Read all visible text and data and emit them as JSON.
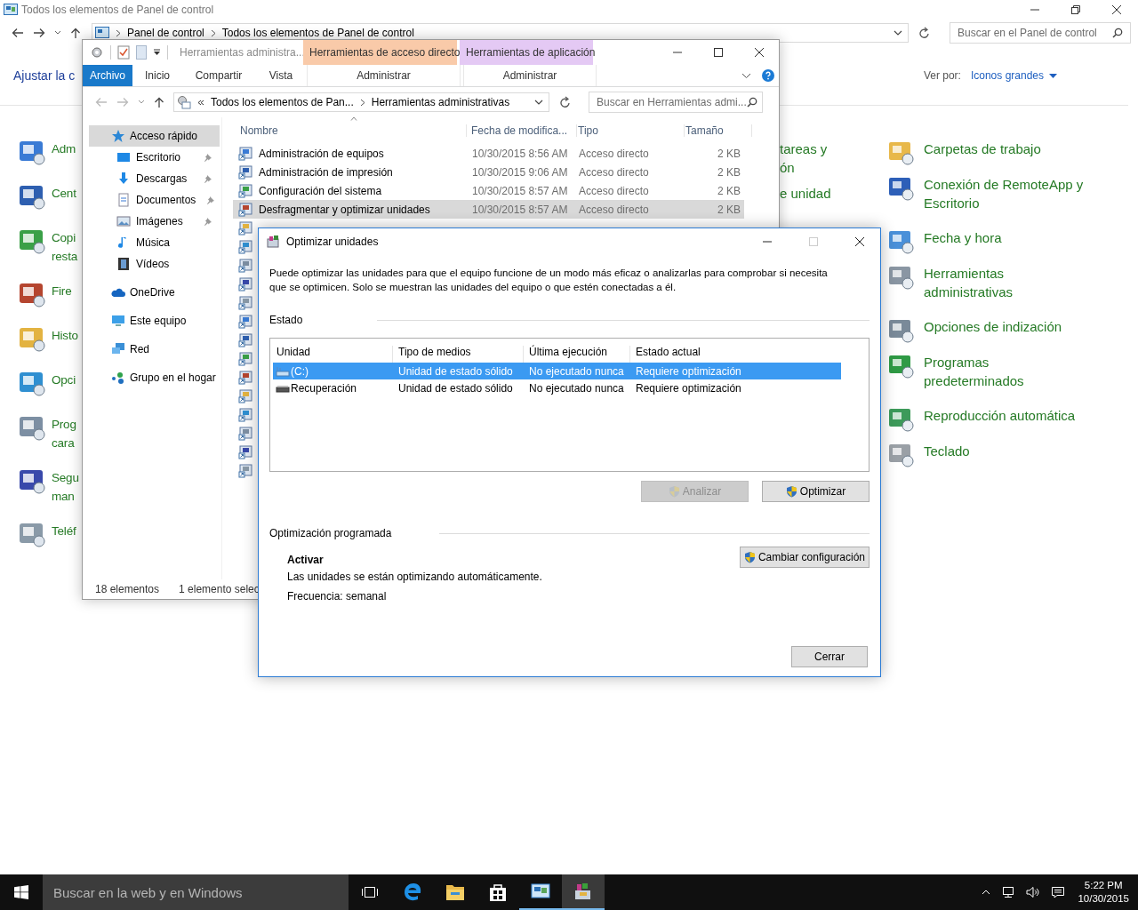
{
  "control_panel": {
    "title": "Todos los elementos de Panel de control",
    "address": [
      "Panel de control",
      "Todos los elementos de Panel de control"
    ],
    "search": {
      "placeholder": "Buscar en el Panel de control"
    },
    "heading": "Ajustar la c",
    "view_by": {
      "label": "Ver por:",
      "value": "Iconos grandes"
    },
    "left_items": [
      {
        "lines": [
          "Adm"
        ]
      },
      {
        "lines": [
          "Cent"
        ]
      },
      {
        "lines": [
          "Copi",
          "resta"
        ]
      },
      {
        "lines": [
          "Fire"
        ]
      },
      {
        "lines": [
          "Histo"
        ]
      },
      {
        "lines": [
          "Opci"
        ]
      },
      {
        "lines": [
          "Prog",
          "cara"
        ]
      },
      {
        "lines": [
          "Segu",
          "man"
        ]
      },
      {
        "lines": [
          "Teléf"
        ]
      }
    ],
    "middle_items": [
      {
        "lines": [
          "tareas y",
          "ón"
        ]
      },
      {
        "lines": [
          "e unidad"
        ]
      }
    ],
    "right_items": [
      {
        "lines": [
          "Carpetas de trabajo"
        ]
      },
      {
        "lines": [
          "Conexión de RemoteApp y",
          "Escritorio"
        ]
      },
      {
        "lines": [
          "Fecha y hora"
        ]
      },
      {
        "lines": [
          "Herramientas",
          "administrativas"
        ]
      },
      {
        "lines": [
          "Opciones de indización"
        ]
      },
      {
        "lines": [
          "Programas",
          "predeterminados"
        ]
      },
      {
        "lines": [
          "Reproducción automática"
        ]
      },
      {
        "lines": [
          "Teclado"
        ]
      }
    ]
  },
  "explorer": {
    "title": "Herramientas administra...",
    "context_groups": [
      {
        "label": "Herramientas de acceso directo",
        "color": "#f9caa9"
      },
      {
        "label": "Herramientas de aplicación",
        "color": "#e4c9f4"
      }
    ],
    "tabs": [
      {
        "label": "Archivo",
        "kind": "file",
        "selected": false
      },
      {
        "label": "Inicio",
        "kind": "tab",
        "selected": false
      },
      {
        "label": "Compartir",
        "kind": "tab",
        "selected": false
      },
      {
        "label": "Vista",
        "kind": "tab",
        "selected": false
      },
      {
        "label": "Administrar",
        "kind": "context",
        "selected": false
      },
      {
        "label": "Administrar",
        "kind": "context",
        "selected": false
      }
    ],
    "address": [
      "Todos los elementos de Pan...",
      "Herramientas administrativas"
    ],
    "search": {
      "placeholder": "Buscar en Herramientas admi..."
    },
    "nav": [
      {
        "label": "Acceso rápido",
        "selected": true,
        "children": [
          {
            "label": "Escritorio",
            "pinned": true,
            "selected": false
          },
          {
            "label": "Descargas",
            "pinned": true,
            "selected": false
          },
          {
            "label": "Documentos",
            "pinned": true,
            "selected": false
          },
          {
            "label": "Imágenes",
            "pinned": true,
            "selected": false
          },
          {
            "label": "Música",
            "pinned": false,
            "selected": false
          },
          {
            "label": "Vídeos",
            "pinned": false,
            "selected": false
          }
        ]
      },
      {
        "label": "OneDrive",
        "selected": false
      },
      {
        "label": "Este equipo",
        "selected": false
      },
      {
        "label": "Red",
        "selected": false
      },
      {
        "label": "Grupo en el hogar",
        "selected": false
      }
    ],
    "columns": [
      "Nombre",
      "Fecha de modifica...",
      "Tipo",
      "Tamaño"
    ],
    "rows": [
      {
        "name": "Administración de equipos",
        "date": "10/30/2015 8:56 AM",
        "type": "Acceso directo",
        "size": "2 KB",
        "selected": false
      },
      {
        "name": "Administración de impresión",
        "date": "10/30/2015 9:06 AM",
        "type": "Acceso directo",
        "size": "2 KB",
        "selected": false
      },
      {
        "name": "Configuración del sistema",
        "date": "10/30/2015 8:57 AM",
        "type": "Acceso directo",
        "size": "2 KB",
        "selected": false
      },
      {
        "name": "Desfragmentar y optimizar unidades",
        "date": "10/30/2015 8:57 AM",
        "type": "Acceso directo",
        "size": "2 KB",
        "selected": true
      },
      {
        "selected": false
      },
      {
        "selected": false
      },
      {
        "selected": false
      },
      {
        "selected": false
      },
      {
        "selected": false
      },
      {
        "selected": false
      },
      {
        "selected": false
      },
      {
        "selected": false
      },
      {
        "selected": false
      },
      {
        "selected": false
      },
      {
        "selected": false
      },
      {
        "selected": false
      },
      {
        "selected": false
      },
      {
        "selected": false
      }
    ],
    "status": [
      "18 elementos",
      "1 elemento selec"
    ]
  },
  "dialog": {
    "title": "Optimizar unidades",
    "description": "Puede optimizar las unidades para que el equipo funcione de un modo más eficaz o analizarlas para comprobar si necesita que se optimicen. Solo se muestran las unidades del equipo o que estén conectadas a él.",
    "status_label": "Estado",
    "columns": [
      "Unidad",
      "Tipo de medios",
      "Última ejecución",
      "Estado actual"
    ],
    "drives": [
      {
        "kind": "ssd",
        "name": "(C:)",
        "media": "Unidad de estado sólido",
        "last_run": "No ejecutado nunca",
        "status": "Requiere optimización",
        "selected": true
      },
      {
        "kind": "disk",
        "name": "Recuperación",
        "media": "Unidad de estado sólido",
        "last_run": "No ejecutado nunca",
        "status": "Requiere optimización",
        "selected": false
      }
    ],
    "buttons": [
      {
        "label": "Analizar",
        "disabled": true
      },
      {
        "label": "Optimizar",
        "disabled": false
      }
    ],
    "schedule_label": "Optimización programada",
    "schedule_state": "Activar",
    "schedule_text": "Las unidades se están optimizando automáticamente.",
    "frequency": "Frecuencia: semanal",
    "change_button": "Cambiar configuración",
    "close_button": "Cerrar"
  },
  "taskbar": {
    "search": {
      "placeholder": "Buscar en la web y en Windows"
    },
    "apps": [
      {
        "open": false,
        "selected": false
      },
      {
        "open": false,
        "selected": false
      },
      {
        "open": false,
        "selected": false
      },
      {
        "open": true,
        "selected": false
      },
      {
        "open": true,
        "selected": true
      }
    ],
    "time": "5:22 PM",
    "date": "10/30/2015"
  }
}
